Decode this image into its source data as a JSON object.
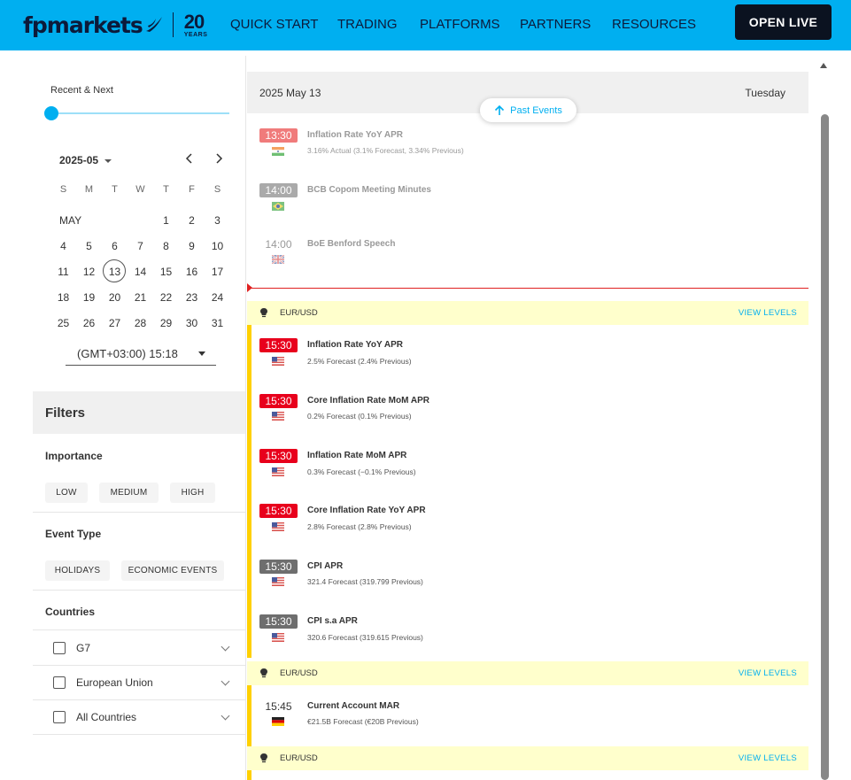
{
  "header": {
    "logo_text": "fpmarkets",
    "years_number": "20",
    "years_label": "YEARS",
    "nav": [
      "QUICK START",
      "TRADING",
      "PLATFORMS",
      "PARTNERS",
      "RESOURCES"
    ],
    "cta": "OPEN LIVE",
    "colors": {
      "bar": "#00aff0",
      "cta_bg": "#0b1220"
    }
  },
  "sidebar": {
    "range_label": "Recent & Next",
    "month": "2025-05",
    "prev_icon": "chevron-left-icon",
    "next_icon": "chevron-right-icon",
    "weekdays": [
      "S",
      "M",
      "T",
      "W",
      "T",
      "F",
      "S"
    ],
    "month_name": "MAY",
    "week1": [
      "1",
      "2",
      "3"
    ],
    "weeks": [
      [
        "4",
        "5",
        "6",
        "7",
        "8",
        "9",
        "10"
      ],
      [
        "11",
        "12",
        "13",
        "14",
        "15",
        "16",
        "17"
      ],
      [
        "18",
        "19",
        "20",
        "21",
        "22",
        "23",
        "24"
      ],
      [
        "25",
        "26",
        "27",
        "28",
        "29",
        "30",
        "31"
      ]
    ],
    "today": "13",
    "timezone": "(GMT+03:00) 15:18",
    "filters_title": "Filters",
    "importance_label": "Importance",
    "importance_chips": [
      "LOW",
      "MEDIUM",
      "HIGH"
    ],
    "event_type_label": "Event Type",
    "event_type_chips": [
      "HOLIDAYS",
      "ECONOMIC EVENTS"
    ],
    "countries_label": "Countries",
    "countries": [
      "G7",
      "European Union",
      "All Countries"
    ]
  },
  "calendar": {
    "date": "2025 May 13",
    "weekday": "Tuesday",
    "past_events_button": "Past Events",
    "past_events": [
      {
        "time": "13:30",
        "importance": "high",
        "flag": "india-flag-icon",
        "title": "Inflation Rate YoY APR",
        "detail": "3.16% Actual (3.1% Forecast, 3.34% Previous)"
      },
      {
        "time": "14:00",
        "importance": "medium",
        "flag": "brazil-flag-icon",
        "title": "BCB Copom Meeting Minutes",
        "detail": ""
      },
      {
        "time": "14:00",
        "importance": "low",
        "flag": "uk-flag-icon",
        "title": "BoE Benford Speech",
        "detail": ""
      }
    ],
    "groups": [
      {
        "pair": "EUR/USD",
        "link": "VIEW LEVELS",
        "events": [
          {
            "time": "15:30",
            "importance": "high",
            "flag": "us-flag-icon",
            "title": "Inflation Rate YoY APR",
            "detail": "2.5% Forecast (2.4% Previous)"
          },
          {
            "time": "15:30",
            "importance": "high",
            "flag": "us-flag-icon",
            "title": "Core Inflation Rate MoM APR",
            "detail": "0.2% Forecast (0.1% Previous)"
          },
          {
            "time": "15:30",
            "importance": "high",
            "flag": "us-flag-icon",
            "title": "Inflation Rate MoM APR",
            "detail": "0.3% Forecast (−0.1% Previous)"
          },
          {
            "time": "15:30",
            "importance": "high",
            "flag": "us-flag-icon",
            "title": "Core Inflation Rate YoY APR",
            "detail": "2.8% Forecast (2.8% Previous)"
          },
          {
            "time": "15:30",
            "importance": "medium",
            "flag": "us-flag-icon",
            "title": "CPI APR",
            "detail": "321.4 Forecast (319.799 Previous)"
          },
          {
            "time": "15:30",
            "importance": "medium",
            "flag": "us-flag-icon",
            "title": "CPI s.a APR",
            "detail": "320.6 Forecast (319.615 Previous)"
          }
        ]
      },
      {
        "pair": "EUR/USD",
        "link": "VIEW LEVELS",
        "events": [
          {
            "time": "15:45",
            "importance": "low",
            "flag": "germany-flag-icon",
            "title": "Current Account MAR",
            "detail": "€21.5B Forecast (€20B Previous)"
          }
        ]
      },
      {
        "pair": "EUR/USD",
        "link": "VIEW LEVELS",
        "events": []
      }
    ],
    "importance_colors": {
      "high": "#e8001c",
      "high_past": "#f07b7b",
      "medium": "#6e6e6e",
      "medium_past": "#aaaaaa",
      "low": "#555555"
    },
    "group_highlight": "#ffffcc",
    "group_marker": "#ffd000",
    "now_line": "#e02020"
  }
}
